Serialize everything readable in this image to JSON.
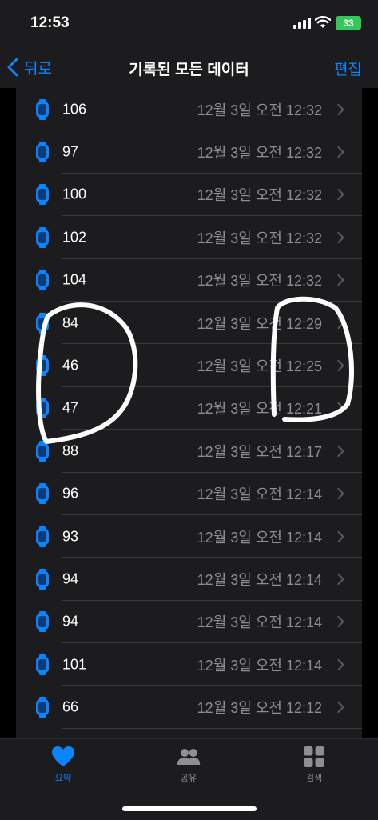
{
  "status": {
    "time": "12:53",
    "battery": "33"
  },
  "nav": {
    "back_label": "뒤로",
    "title": "기록된 모든 데이터",
    "edit_label": "편집"
  },
  "rows": [
    {
      "value": "106",
      "date": "12월 3일 오전 12:32"
    },
    {
      "value": "97",
      "date": "12월 3일 오전 12:32"
    },
    {
      "value": "100",
      "date": "12월 3일 오전 12:32"
    },
    {
      "value": "102",
      "date": "12월 3일 오전 12:32"
    },
    {
      "value": "104",
      "date": "12월 3일 오전 12:32"
    },
    {
      "value": "84",
      "date": "12월 3일 오전 12:29"
    },
    {
      "value": "46",
      "date": "12월 3일 오전 12:25"
    },
    {
      "value": "47",
      "date": "12월 3일 오전 12:21"
    },
    {
      "value": "88",
      "date": "12월 3일 오전 12:17"
    },
    {
      "value": "96",
      "date": "12월 3일 오전 12:14"
    },
    {
      "value": "93",
      "date": "12월 3일 오전 12:14"
    },
    {
      "value": "94",
      "date": "12월 3일 오전 12:14"
    },
    {
      "value": "94",
      "date": "12월 3일 오전 12:14"
    },
    {
      "value": "101",
      "date": "12월 3일 오전 12:14"
    },
    {
      "value": "66",
      "date": "12월 3일 오전 12:12"
    }
  ],
  "tabs": [
    {
      "label": "요약",
      "icon": "heart-icon",
      "active": true
    },
    {
      "label": "공유",
      "icon": "people-icon",
      "active": false
    },
    {
      "label": "검색",
      "icon": "grid-icon",
      "active": false
    }
  ],
  "colors": {
    "accent": "#0a84ff",
    "battery": "#34c759",
    "secondary_text": "#8e8e93",
    "inactive_tab": "#8e8e93"
  }
}
